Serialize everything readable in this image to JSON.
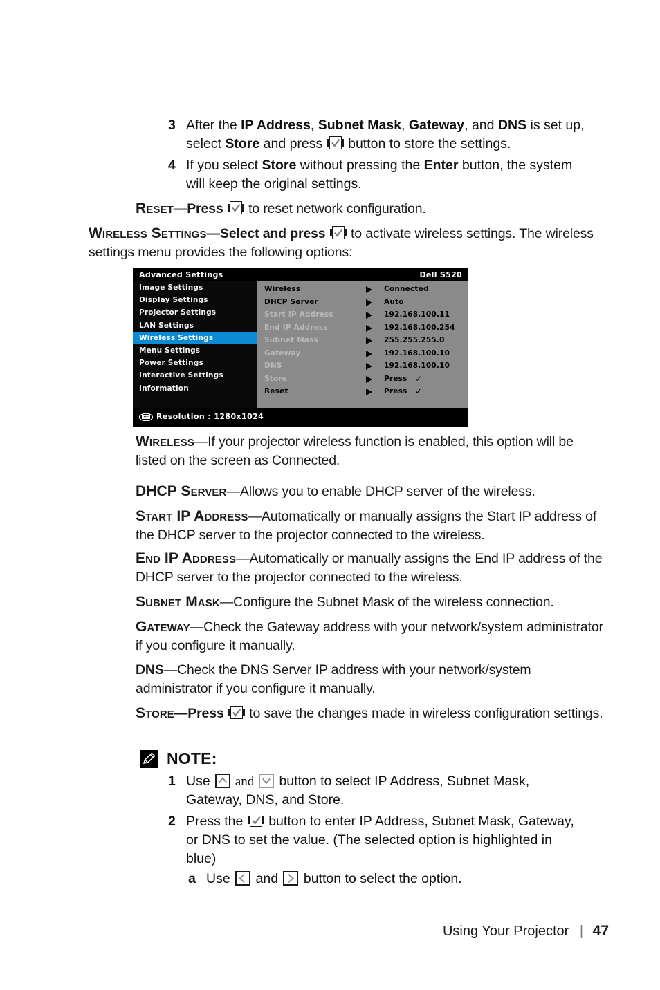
{
  "steps": [
    {
      "num": "3",
      "seg": [
        {
          "t": "After the ",
          "s": "n"
        },
        {
          "t": "IP Address",
          "s": "b"
        },
        {
          "t": ", ",
          "s": "n"
        },
        {
          "t": "Subnet Mask",
          "s": "b"
        },
        {
          "t": ", ",
          "s": "n"
        },
        {
          "t": "Gateway",
          "s": "b"
        },
        {
          "t": ", and ",
          "s": "n"
        },
        {
          "t": "DNS",
          "s": "b"
        },
        {
          "t": " is set up, select ",
          "s": "n"
        },
        {
          "t": "Store",
          "s": "b"
        },
        {
          "t": " and press ",
          "s": "n"
        },
        {
          "t": "",
          "s": "enter-icon"
        },
        {
          "t": " button to store the settings.",
          "s": "n"
        }
      ]
    },
    {
      "num": "4",
      "seg": [
        {
          "t": "If you select ",
          "s": "n"
        },
        {
          "t": "Store",
          "s": "b"
        },
        {
          "t": " without pressing the ",
          "s": "n"
        },
        {
          "t": "Enter",
          "s": "b"
        },
        {
          "t": " button, the system will keep the original settings.",
          "s": "n"
        }
      ]
    }
  ],
  "reset_para": {
    "term": "Reset",
    "seg": [
      {
        "t": "—Press ",
        "s": "dash"
      },
      {
        "t": "",
        "s": "enter-icon"
      },
      {
        "t": " to reset network configuration.",
        "s": "n"
      }
    ]
  },
  "wireless_settings_para": {
    "term": "Wireless Settings",
    "seg": [
      {
        "t": "—Select and press ",
        "s": "dash"
      },
      {
        "t": "",
        "s": "enter-icon"
      },
      {
        "t": " to activate wireless settings. The wireless settings menu provides the following options:",
        "s": "n"
      }
    ]
  },
  "osd": {
    "title": "Advanced Settings",
    "model": "Dell S520",
    "menu": [
      {
        "label": "Image Settings",
        "active": false
      },
      {
        "label": "Display Settings",
        "active": false
      },
      {
        "label": "Projector Settings",
        "active": false
      },
      {
        "label": "LAN Settings",
        "active": false
      },
      {
        "label": "Wireless Settings",
        "active": true
      },
      {
        "label": "Menu Settings",
        "active": false
      },
      {
        "label": "Power Settings",
        "active": false
      },
      {
        "label": "Interactive Settings",
        "active": false
      },
      {
        "label": "Information",
        "active": false
      }
    ],
    "rows": [
      {
        "label": "Wireless",
        "value": "Connected",
        "dim": false,
        "check": false
      },
      {
        "label": "DHCP Server",
        "value": "Auto",
        "dim": false,
        "check": false
      },
      {
        "label": "Start IP Address",
        "value": "192.168.100.11",
        "dim": true,
        "check": false
      },
      {
        "label": "End IP Address",
        "value": "192.168.100.254",
        "dim": true,
        "check": false
      },
      {
        "label": "Subnet Mask",
        "value": "255.255.255.0",
        "dim": true,
        "check": false
      },
      {
        "label": "Gateway",
        "value": "192.168.100.10",
        "dim": true,
        "check": false
      },
      {
        "label": "DNS",
        "value": "192.168.100.10",
        "dim": true,
        "check": false
      },
      {
        "label": "Store",
        "value": "Press",
        "dim": true,
        "check": true
      },
      {
        "label": "Reset",
        "value": "Press",
        "dim": false,
        "check": true
      }
    ],
    "footer": "Resolution :  1280x1024",
    "highlight_color": "#0c8ad6",
    "panel_color": "#8a8a8a"
  },
  "definitions": [
    {
      "term": "Wireless",
      "body": "—If your projector wireless function is enabled, this option will be listed on the screen as Connected."
    },
    {
      "term": "DHCP Server",
      "body": "—Allows you to enable DHCP server of the wireless."
    },
    {
      "term": "Start IP Address",
      "body": "—Automatically or manually assigns the Start IP address of the DHCP server to the projector connected to the wireless."
    },
    {
      "term": "End IP Address",
      "body": "—Automatically or manually assigns the End IP address of the DHCP server to the projector connected to the wireless."
    },
    {
      "term": "Subnet Mask",
      "body": "—Configure the Subnet Mask of the wireless connection."
    },
    {
      "term": "Gateway",
      "body": "—Check the Gateway address with your network/system administrator if you configure it manually."
    },
    {
      "term": "DNS",
      "body": "—Check the DNS Server IP address with your network/system administrator if you configure it manually.",
      "plain": true
    }
  ],
  "store_para": {
    "term": "Store",
    "seg": [
      {
        "t": "—Press ",
        "s": "dash"
      },
      {
        "t": "",
        "s": "enter-icon"
      },
      {
        "t": " to save the changes made in wireless configuration settings.",
        "s": "n"
      }
    ]
  },
  "note": {
    "icon": "pencil-note-icon",
    "label": "NOTE:",
    "items": [
      {
        "num": "1",
        "seg": [
          {
            "t": "Use ",
            "s": "n"
          },
          {
            "t": "",
            "s": "up-icon"
          },
          {
            "t": " and ",
            "s": "serif"
          },
          {
            "t": "",
            "s": "down-icon"
          },
          {
            "t": " button to select IP Address, Subnet Mask, Gateway, DNS, and Store.",
            "s": "n"
          }
        ]
      },
      {
        "num": "2",
        "seg": [
          {
            "t": "Press the ",
            "s": "n"
          },
          {
            "t": "",
            "s": "enter-icon"
          },
          {
            "t": " button to enter IP Address, Subnet Mask, Gateway, or DNS to set the value. (The selected option is highlighted in blue)",
            "s": "n"
          }
        ]
      }
    ],
    "subitem": {
      "num": "a",
      "seg": [
        {
          "t": "Use ",
          "s": "n"
        },
        {
          "t": "",
          "s": "left-icon"
        },
        {
          "t": " and ",
          "s": "n"
        },
        {
          "t": "",
          "s": "right-icon"
        },
        {
          "t": " button to select the option.",
          "s": "n"
        }
      ]
    }
  },
  "footer": {
    "section": "Using Your Projector",
    "separator": "|",
    "page": "47"
  }
}
